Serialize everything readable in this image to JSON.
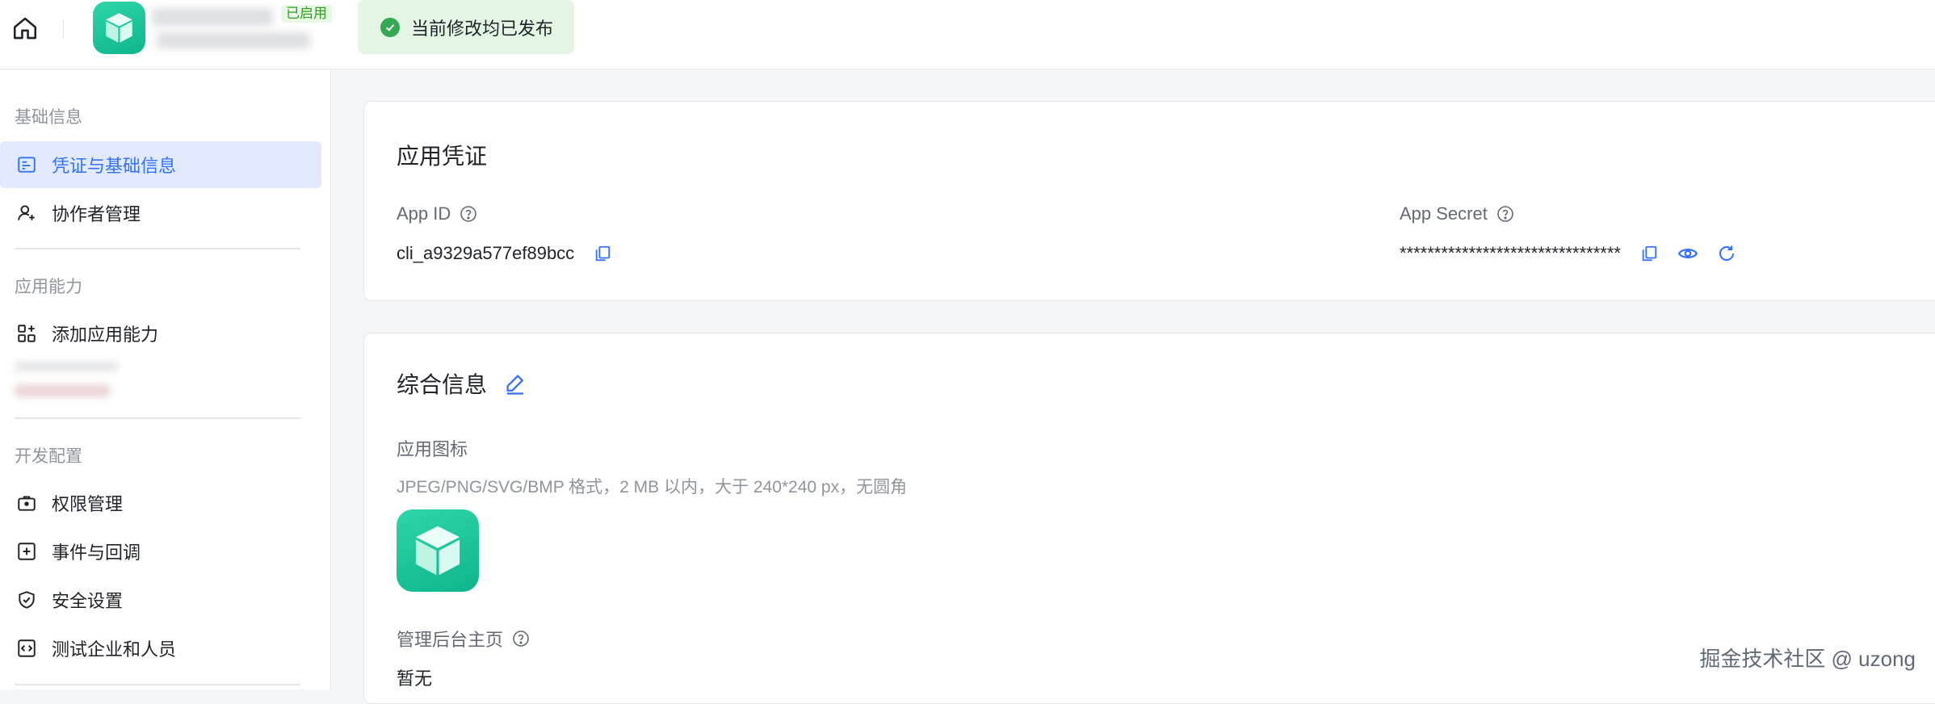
{
  "topbar": {
    "status_badge": "已启用",
    "toast": "当前修改均已发布"
  },
  "sidebar": {
    "sections": [
      {
        "title": "基础信息"
      },
      {
        "title": "应用能力"
      },
      {
        "title": "开发配置"
      }
    ],
    "items": [
      {
        "label": "凭证与基础信息",
        "icon": "credential-icon",
        "active": true
      },
      {
        "label": "协作者管理",
        "icon": "collaborator-icon"
      },
      {
        "label": "添加应用能力",
        "icon": "add-capability-icon"
      },
      {
        "label": "权限管理",
        "icon": "permission-icon"
      },
      {
        "label": "事件与回调",
        "icon": "event-icon"
      },
      {
        "label": "安全设置",
        "icon": "shield-icon"
      },
      {
        "label": "测试企业和人员",
        "icon": "test-code-icon"
      }
    ]
  },
  "credentials": {
    "title": "应用凭证",
    "app_id_label": "App ID",
    "app_id_value": "cli_a9329a577ef89bcc",
    "app_secret_label": "App Secret",
    "app_secret_value": "********************************"
  },
  "general": {
    "title": "综合信息",
    "icon_label": "应用图标",
    "icon_hint": "JPEG/PNG/SVG/BMP 格式，2 MB 以内，大于 240*240 px，无圆角",
    "admin_home_label": "管理后台主页",
    "admin_home_value": "暂无"
  },
  "colors": {
    "accent": "#3370ff",
    "app_logo": "#1cc79b",
    "success": "#34a853"
  },
  "watermark": "掘金技术社区 @ uzong"
}
